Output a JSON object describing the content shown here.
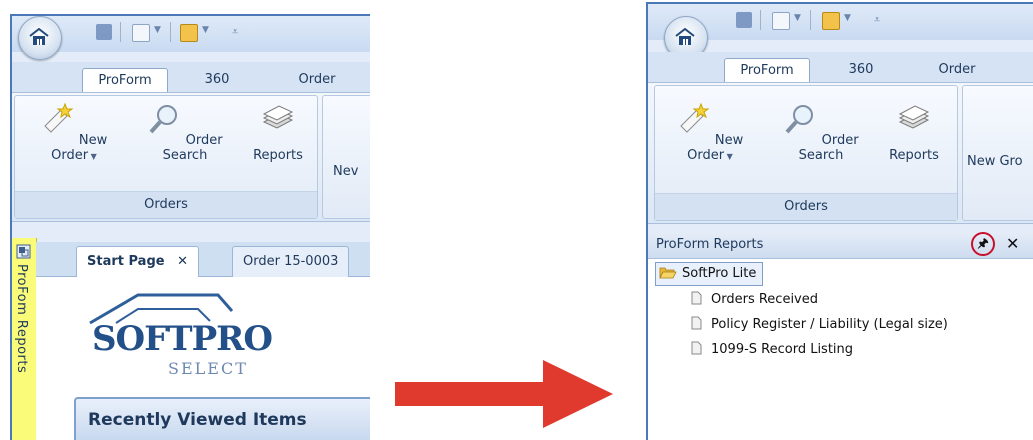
{
  "ribbon": {
    "tabs": [
      "ProForm",
      "360",
      "Order"
    ],
    "buttons": {
      "new_order": "New Order",
      "order_search": "Order Search",
      "reports": "Reports",
      "new_cut_left": "Nev",
      "new_cut_right": "New Gro"
    },
    "group_label": "Orders"
  },
  "left_panel": {
    "side_tab_label": "ProFom  Reports",
    "doc_tabs": {
      "start_page": "Start Page",
      "close_glyph": "✕",
      "order": "Order 15-0003"
    },
    "logo": {
      "main": "SOFTPRO",
      "sub": "SELECT"
    },
    "recent_title": "Recently Viewed Items"
  },
  "right_panel": {
    "reports_title": "ProForm Reports",
    "pin_glyph": "🖈",
    "close_glyph": "✕",
    "folder": "SoftPro Lite",
    "items": [
      "Orders Received",
      "Policy Register / Liability (Legal size)",
      "1099-S Record Listing"
    ]
  },
  "colors": {
    "arrow": "#e03a2f",
    "highlight_ring": "#c8102e",
    "side_tab": "#fbfb7a",
    "ribbon_text": "#1e395b"
  }
}
